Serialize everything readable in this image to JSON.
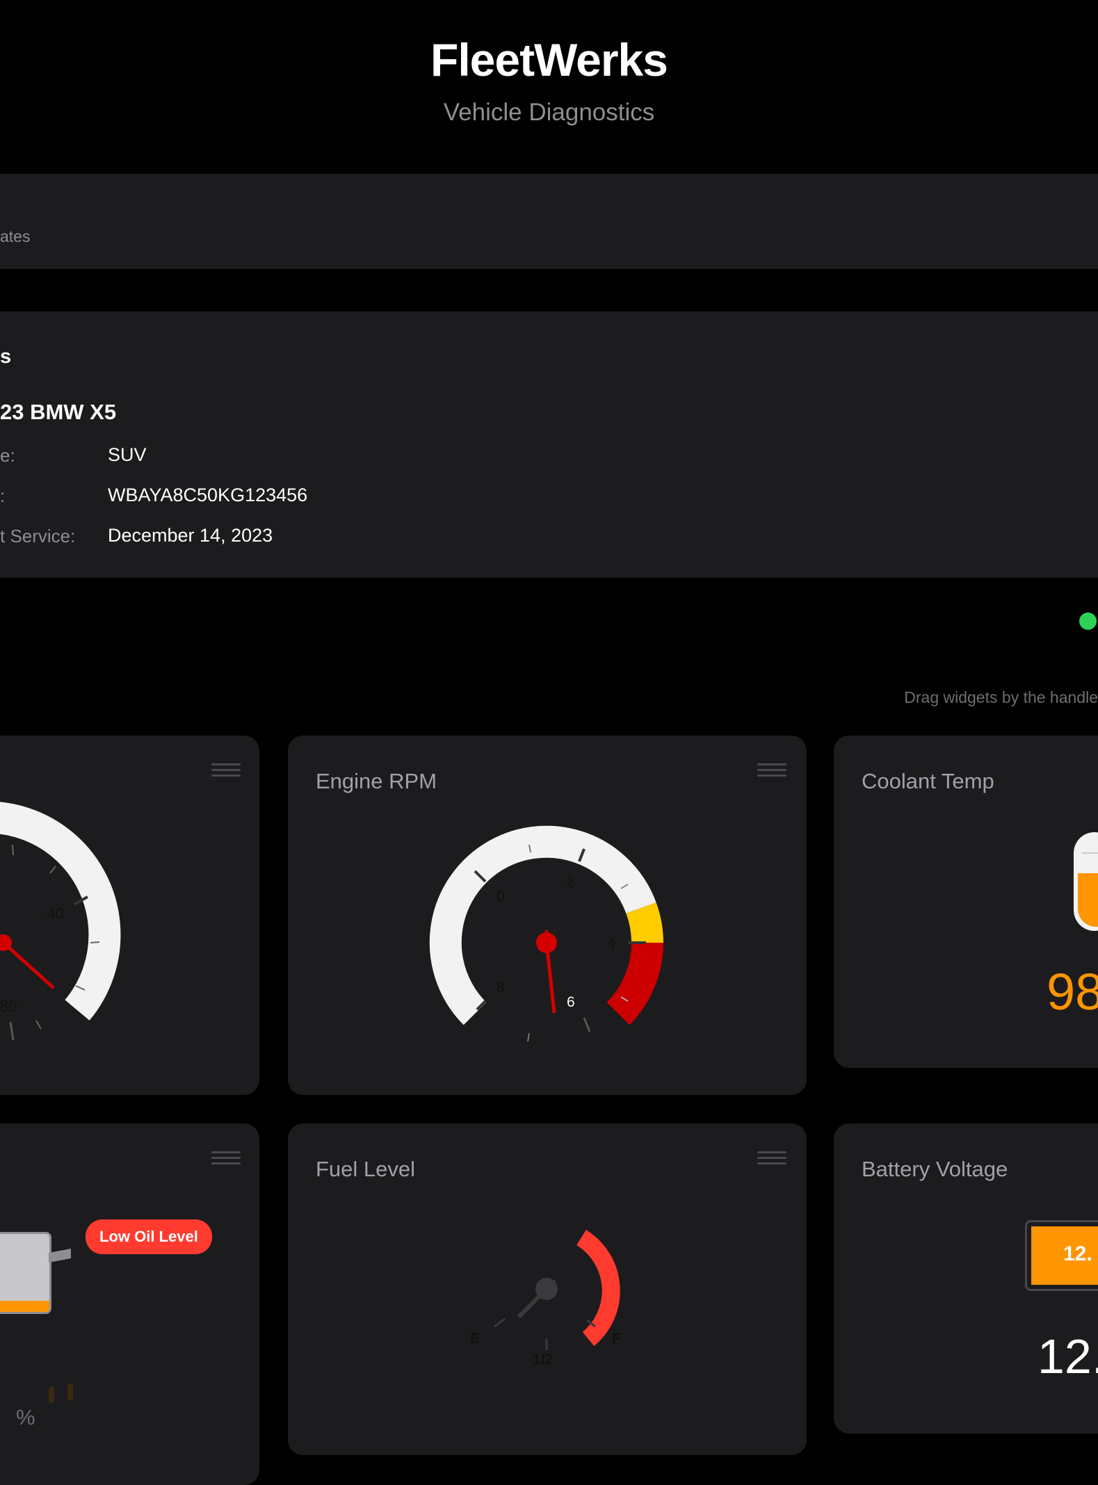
{
  "header": {
    "title": "FleetWerks",
    "subtitle": "Vehicle Diagnostics"
  },
  "banner": {
    "text": "ates"
  },
  "details": {
    "heading": "s",
    "vehicle_name": "23 BMW X5",
    "rows": [
      {
        "label": "e:",
        "value": "SUV"
      },
      {
        "label": ":",
        "value": "WBAYA8C50KG123456"
      },
      {
        "label": "t Service:",
        "value": "December 14, 2023"
      }
    ]
  },
  "status": {
    "dot_color": "#30d158"
  },
  "hint": "Drag widgets by the handle",
  "widgets": {
    "speed": {
      "ticks": [
        "40",
        "80"
      ],
      "needle_color": "#d40000"
    },
    "rpm": {
      "title": "Engine RPM",
      "ticks": [
        "0",
        "2",
        "4",
        "6",
        "8"
      ],
      "zones": {
        "normal": "#f2f2f2",
        "warning": "#ffcc00",
        "danger": "#cc0000"
      }
    },
    "coolant": {
      "title": "Coolant Temp",
      "value": "98",
      "accent": "#ff9500"
    },
    "oil": {
      "badge": "Low Oil Level",
      "value": "5",
      "unit": "%",
      "badge_color": "#ff3b30"
    },
    "fuel": {
      "title": "Fuel Level",
      "labels": {
        "empty": "E",
        "half": "1/2",
        "full": "F"
      },
      "arc_color": "#ff3b30"
    },
    "battery": {
      "title": "Battery Voltage",
      "icon_value": "12.",
      "value": "12."
    }
  }
}
